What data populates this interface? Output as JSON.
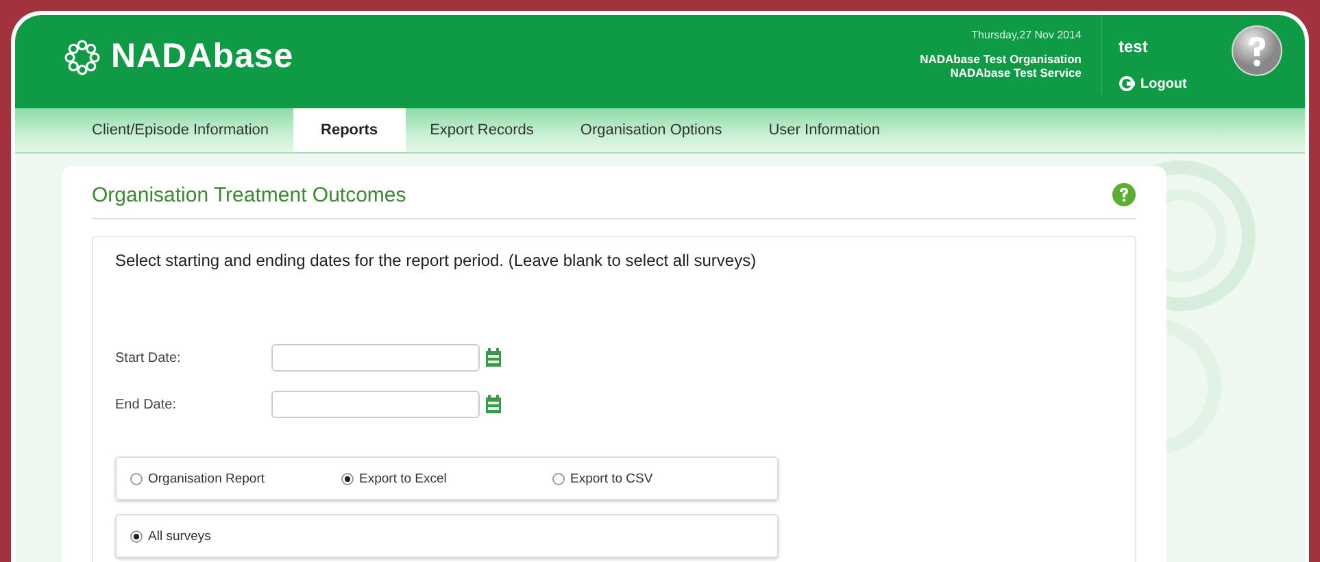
{
  "header": {
    "logo": "NADAbase",
    "date": "Thursday,27 Nov 2014",
    "organisation": "NADAbase Test Organisation",
    "service": "NADAbase Test Service",
    "user": "test",
    "logout": "Logout"
  },
  "tabs": [
    {
      "label": "Client/Episode Information",
      "selected": false
    },
    {
      "label": "Reports",
      "selected": true
    },
    {
      "label": "Export Records",
      "selected": false
    },
    {
      "label": "Organisation Options",
      "selected": false
    },
    {
      "label": "User Information",
      "selected": false
    }
  ],
  "page": {
    "title": "Organisation Treatment Outcomes",
    "instructions": "Select starting and ending dates for the report period. (Leave blank to select all surveys)",
    "date_fields": [
      {
        "label": "Start Date:"
      },
      {
        "label": "End Date:"
      }
    ],
    "output_options": [
      {
        "label": "Organisation Report",
        "selected": false
      },
      {
        "label": "Export to Excel",
        "selected": true
      },
      {
        "label": "Export to CSV",
        "selected": false
      }
    ],
    "survey_options": [
      {
        "label": "All surveys",
        "selected": true
      }
    ]
  }
}
